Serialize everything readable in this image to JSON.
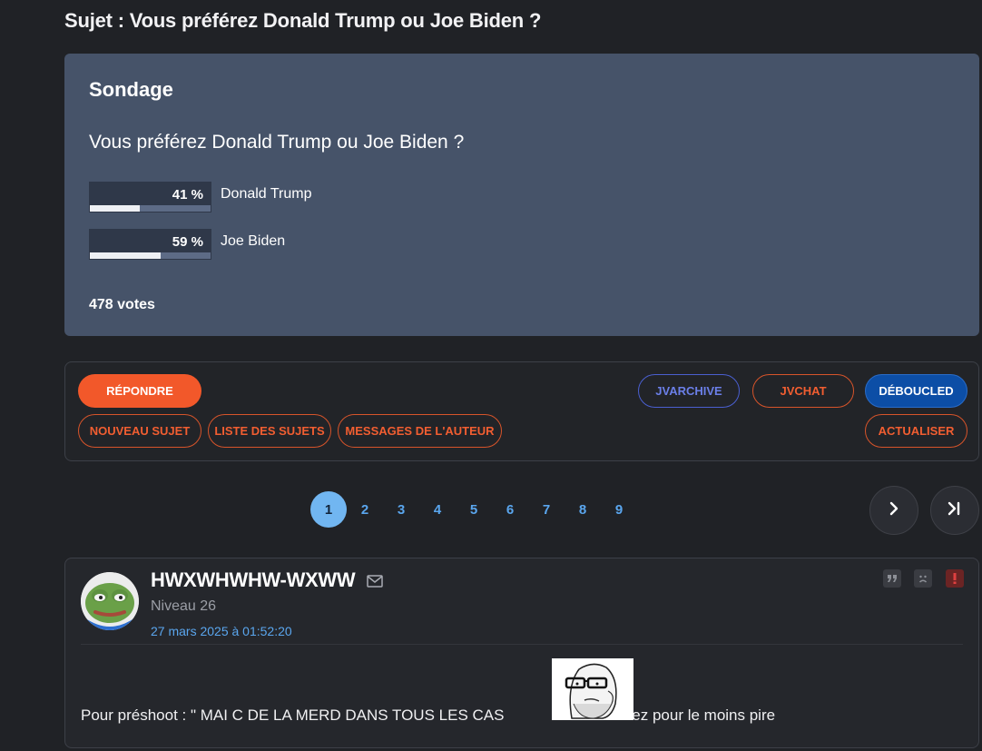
{
  "topic": {
    "title": "Sujet : Vous préférez Donald Trump ou Joe Biden ?"
  },
  "poll": {
    "heading": "Sondage",
    "question": "Vous préférez Donald Trump ou Joe Biden ?",
    "options": [
      {
        "percent_label": "41 %",
        "percent": 41,
        "label": "Donald Trump"
      },
      {
        "percent_label": "59 %",
        "percent": 59,
        "label": "Joe Biden"
      }
    ],
    "total": "478 votes"
  },
  "actions": {
    "reply": "RÉPONDRE",
    "new_topic": "NOUVEAU SUJET",
    "topic_list": "LISTE DES SUJETS",
    "author_messages": "MESSAGES DE L'AUTEUR",
    "jvarchive": "JVARCHIVE",
    "jvchat": "JVCHAT",
    "deboucled": "DÉBOUCLED",
    "refresh": "ACTUALISER"
  },
  "pagination": {
    "pages": [
      "1",
      "2",
      "3",
      "4",
      "5",
      "6",
      "7",
      "8",
      "9"
    ],
    "current": "1",
    "next_icon": "chevron-right-icon",
    "last_icon": "last-page-icon"
  },
  "post": {
    "author": "HWXWHWHW-WXWW",
    "level": "Niveau 26",
    "date": "27 mars 2025 à 01:52:20",
    "text_before": "Pour préshoot : \" MAI C DE LA MERD DANS TOUS LES CAS",
    "text_after": "\" Votez pour le moins pire",
    "icons": [
      "quote-icon",
      "sad-face-icon",
      "report-icon",
      "mail-icon"
    ]
  },
  "colors": {
    "background": "#202226",
    "poll_bg": "#465369",
    "accent_orange": "#f2582a",
    "link_blue": "#5aa6ee",
    "active_page": "#71b6f1",
    "deboucled_blue": "#0c4ea6"
  }
}
